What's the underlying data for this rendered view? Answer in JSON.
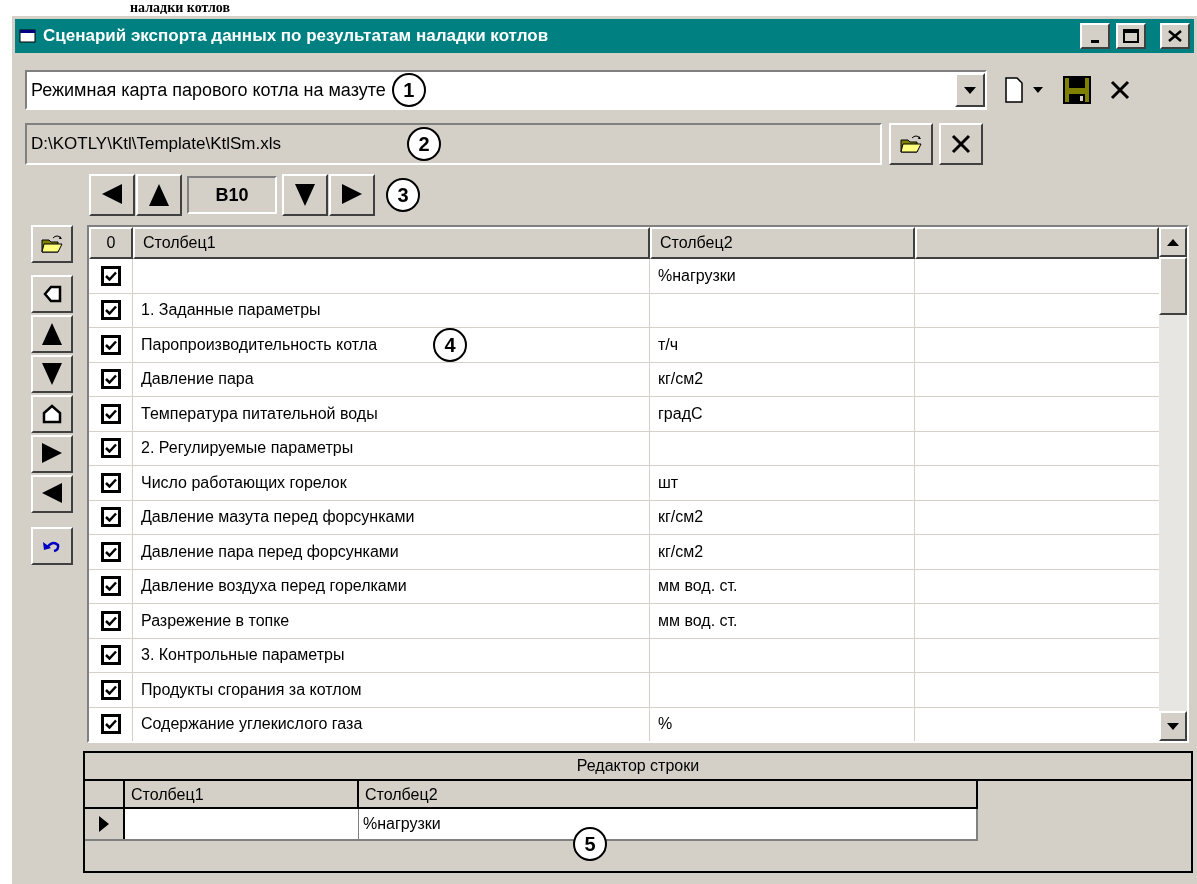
{
  "document_caption": "наладки котлов",
  "window": {
    "title": "Сценарий экспорта данных по результатам наладки котлов"
  },
  "template_select": {
    "value": "Режимная карта парового котла на мазуте"
  },
  "file_path": {
    "value": "D:\\KOTLY\\Ktl\\Template\\KtlSm.xls"
  },
  "cell_nav": {
    "cell": "B10"
  },
  "callouts": [
    "1",
    "2",
    "3",
    "4",
    "5"
  ],
  "grid": {
    "columns": [
      "0",
      "Столбец1",
      "Столбец2"
    ],
    "rows": [
      {
        "checked": true,
        "col2": "%нагрузки"
      },
      {
        "checked": true,
        "col1": "1. Заданные параметры"
      },
      {
        "checked": true,
        "col1": "Паропроизводительность котла",
        "col2": "т/ч"
      },
      {
        "checked": true,
        "col1": "Давление пара",
        "col2": "кг/см2"
      },
      {
        "checked": true,
        "col1": "Температура питательной воды",
        "col2": "градС"
      },
      {
        "checked": true,
        "col1": "2. Регулируемые параметры"
      },
      {
        "checked": true,
        "col1": "Число работающих горелок",
        "col2": "шт"
      },
      {
        "checked": true,
        "col1": "Давление мазута перед форсунками",
        "col2": "кг/см2"
      },
      {
        "checked": true,
        "col1": "Давление пара перед форсунками",
        "col2": "кг/см2"
      },
      {
        "checked": true,
        "col1": "Давление воздуха перед горелками",
        "col2": "мм вод. ст."
      },
      {
        "checked": true,
        "col1": "Разрежение в топке",
        "col2": "мм вод. ст."
      },
      {
        "checked": true,
        "col1": "3. Контрольные параметры"
      },
      {
        "checked": true,
        "col1": "Продукты сгорания за котлом"
      },
      {
        "checked": true,
        "col1": "Содержание углекислого газа",
        "col2": "%"
      }
    ]
  },
  "row_editor": {
    "title": "Редактор строки",
    "columns": [
      "Столбец1",
      "Столбец2"
    ],
    "row": {
      "col2": "%нагрузки"
    }
  }
}
